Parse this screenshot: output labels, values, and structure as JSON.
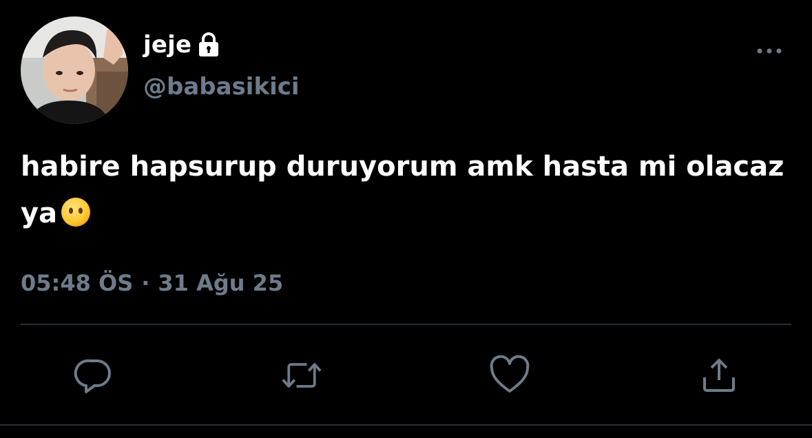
{
  "author": {
    "display_name": "jeje",
    "handle": "@babasikici",
    "avatar_icon": "profile-photo",
    "lock_icon": "lock-icon"
  },
  "tweet": {
    "text": "habire hapsurup duruyorum amk hasta mi olacaz ya",
    "emoji": "face-without-mouth-emoji"
  },
  "meta": {
    "time": "05:48 ÖS",
    "separator": "·",
    "date": "31 Ağu 25"
  },
  "actions": [
    {
      "name": "reply",
      "icon": "reply-icon"
    },
    {
      "name": "retweet",
      "icon": "retweet-icon"
    },
    {
      "name": "like",
      "icon": "heart-icon"
    },
    {
      "name": "share",
      "icon": "share-icon"
    }
  ],
  "colors": {
    "background": "#000000",
    "text_primary": "#ffffff",
    "text_secondary": "#6e7c8a",
    "divider": "#2b2f33"
  }
}
